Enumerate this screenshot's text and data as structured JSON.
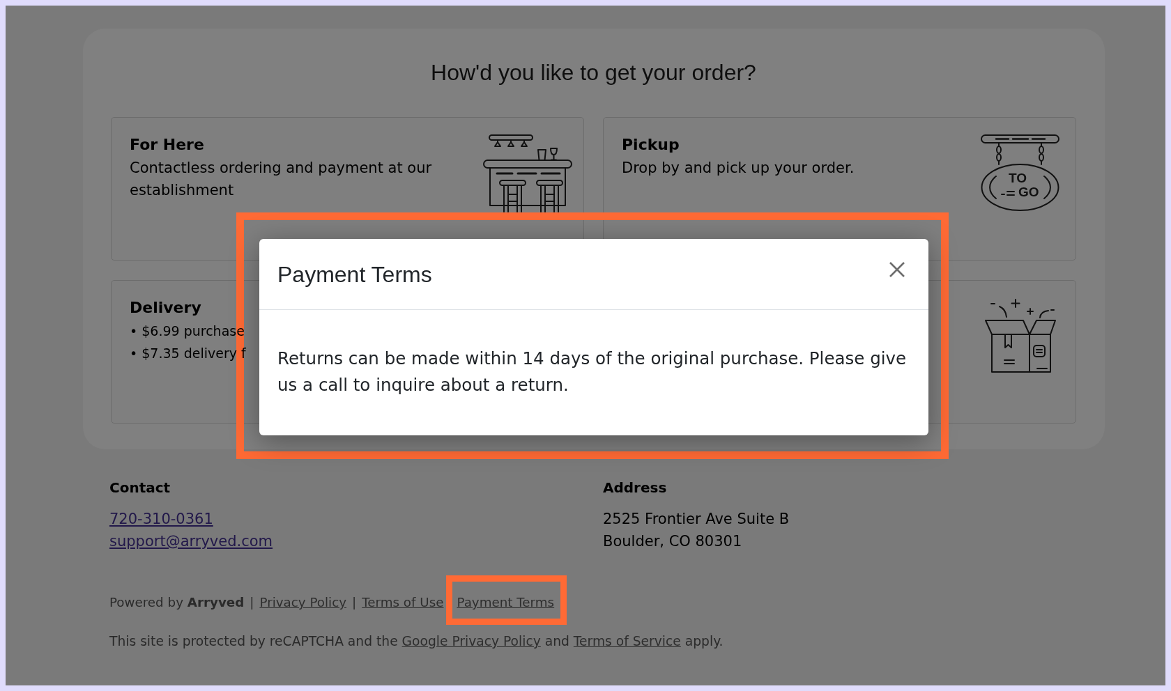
{
  "page": {
    "heading": "How'd you like to get your order?",
    "options": [
      {
        "title": "For Here",
        "description": "Contactless ordering and payment at our establishment",
        "selected": false
      },
      {
        "title": "Pickup",
        "description": "Drop by and pick up your order.",
        "sign_lines": [
          "TO",
          "GO"
        ],
        "selected": false
      },
      {
        "title": "Delivery",
        "bullets": [
          "• $6.99 purchase",
          "• $7.35 delivery f"
        ],
        "selected": false
      },
      {
        "selected": false
      }
    ]
  },
  "footer": {
    "contact": {
      "heading": "Contact",
      "links": [
        "720-310-0361",
        "support@arryved.com"
      ]
    },
    "address": {
      "heading": "Address",
      "lines": [
        "2525 Frontier Ave Suite B",
        "Boulder, CO 80301"
      ]
    },
    "links_line": [
      {
        "kind": "text",
        "text": "Powered by **Arryved**"
      },
      {
        "kind": "separator",
        "text": "|"
      },
      {
        "kind": "link",
        "text": "Privacy Policy",
        "highlighted": false
      },
      {
        "kind": "separator",
        "text": "|"
      },
      {
        "kind": "link",
        "text": "Terms of Use",
        "highlighted": false
      },
      {
        "kind": "link",
        "text": "Payment Terms",
        "highlighted": true
      }
    ],
    "recaptcha_notice": [
      {
        "kind": "text",
        "text": "This site is protected by reCAPTCHA and the "
      },
      {
        "kind": "link",
        "text": "Google Privacy Policy"
      },
      {
        "kind": "text",
        "text": " and "
      },
      {
        "kind": "link",
        "text": "Terms of Service"
      },
      {
        "kind": "text",
        "text": " apply."
      }
    ]
  },
  "modal": {
    "title": "Payment Terms",
    "text": "Returns can be made within 14 days of the original purchase. Please give us a call to inquire about a return.",
    "highlighted": true
  }
}
